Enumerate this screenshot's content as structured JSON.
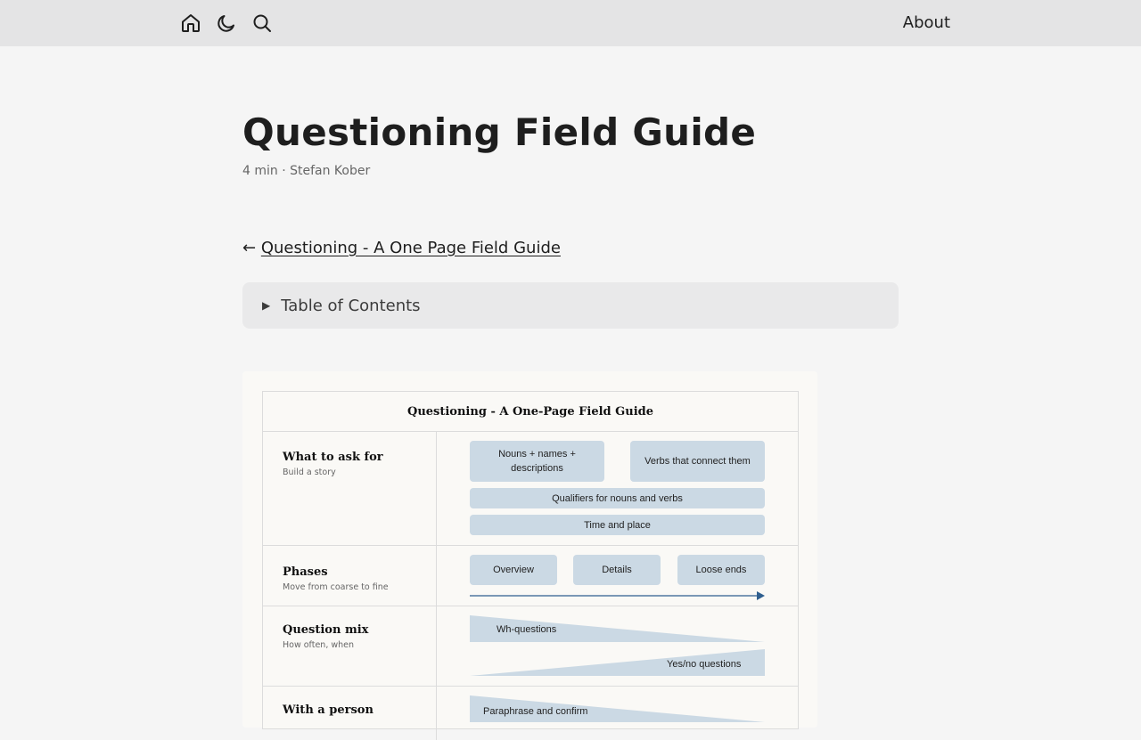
{
  "nav": {
    "about_label": "About"
  },
  "article": {
    "title": "Questioning Field Guide",
    "meta": "4 min · Stefan Kober",
    "back_arrow": "←",
    "back_link": "Questioning - A One Page Field Guide",
    "toc_arrow": "▶",
    "toc_label": "Table of Contents"
  },
  "figure": {
    "title": "Questioning - A One-Page Field Guide",
    "rows": [
      {
        "label": "What to ask for",
        "sub": "Build a story",
        "chips": [
          "Nouns + names + descriptions",
          "Verbs that connect them",
          "Qualifiers for nouns and verbs",
          "Time and place"
        ]
      },
      {
        "label": "Phases",
        "sub": "Move from coarse to fine",
        "chips": [
          "Overview",
          "Details",
          "Loose ends"
        ]
      },
      {
        "label": "Question mix",
        "sub": "How often, when",
        "wedges": [
          "Wh-questions",
          "Yes/no questions"
        ]
      },
      {
        "label": "With a person",
        "wedges": [
          "Paraphrase and confirm"
        ]
      }
    ]
  },
  "colors": {
    "topbar": "#e4e4e5",
    "chip": "#cbd9e4",
    "arrow": "#2f5f8f"
  }
}
